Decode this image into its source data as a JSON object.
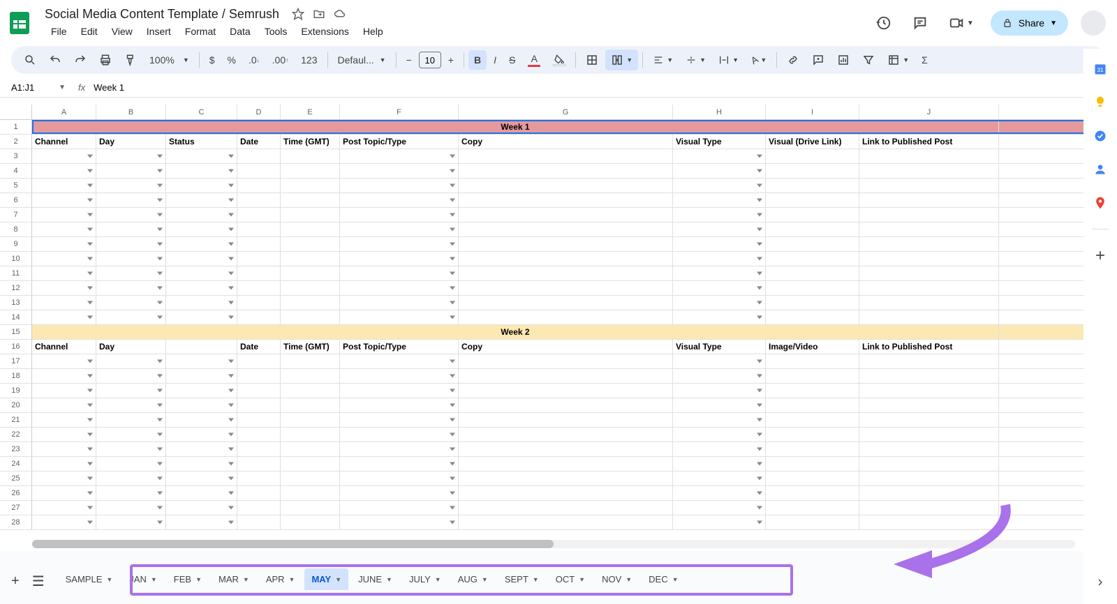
{
  "doc": {
    "title": "Social Media Content Template / Semrush"
  },
  "menus": [
    "File",
    "Edit",
    "View",
    "Insert",
    "Format",
    "Data",
    "Tools",
    "Extensions",
    "Help"
  ],
  "toolbar": {
    "zoom": "100%",
    "font": "Defaul...",
    "font_size": "10"
  },
  "share_label": "Share",
  "name_box": "A1:J1",
  "formula_value": "Week 1",
  "columns": [
    "A",
    "B",
    "C",
    "D",
    "E",
    "F",
    "G",
    "H",
    "I",
    "J"
  ],
  "row_numbers": [
    "1",
    "2",
    "3",
    "4",
    "5",
    "6",
    "7",
    "8",
    "9",
    "10",
    "11",
    "12",
    "13",
    "14",
    "15",
    "16",
    "17",
    "18",
    "19",
    "20",
    "21",
    "22",
    "23",
    "24",
    "25",
    "26",
    "27",
    "28"
  ],
  "week1_label": "Week 1",
  "week2_label": "Week 2",
  "headers1": {
    "channel": "Channel",
    "day": "Day",
    "status": "Status",
    "date": "Date",
    "time": "Time (GMT)",
    "topic": "Post Topic/Type",
    "copy": "Copy",
    "visual_type": "Visual Type",
    "visual_link": "Visual (Drive Link)",
    "published": "Link to Published Post"
  },
  "headers2": {
    "channel": "Channel",
    "day": "Day",
    "status": "",
    "date": "Date",
    "time": "Time (GMT)",
    "topic": "Post Topic/Type",
    "copy": "Copy",
    "visual_type": "Visual Type",
    "visual_link": "Image/Video",
    "published": "Link to Published Post"
  },
  "tabs": [
    "SAMPLE",
    "JAN",
    "FEB",
    "MAR",
    "APR",
    "MAY",
    "JUNE",
    "JULY",
    "AUG",
    "SEPT",
    "OCT",
    "NOV",
    "DEC"
  ],
  "active_tab": "MAY"
}
